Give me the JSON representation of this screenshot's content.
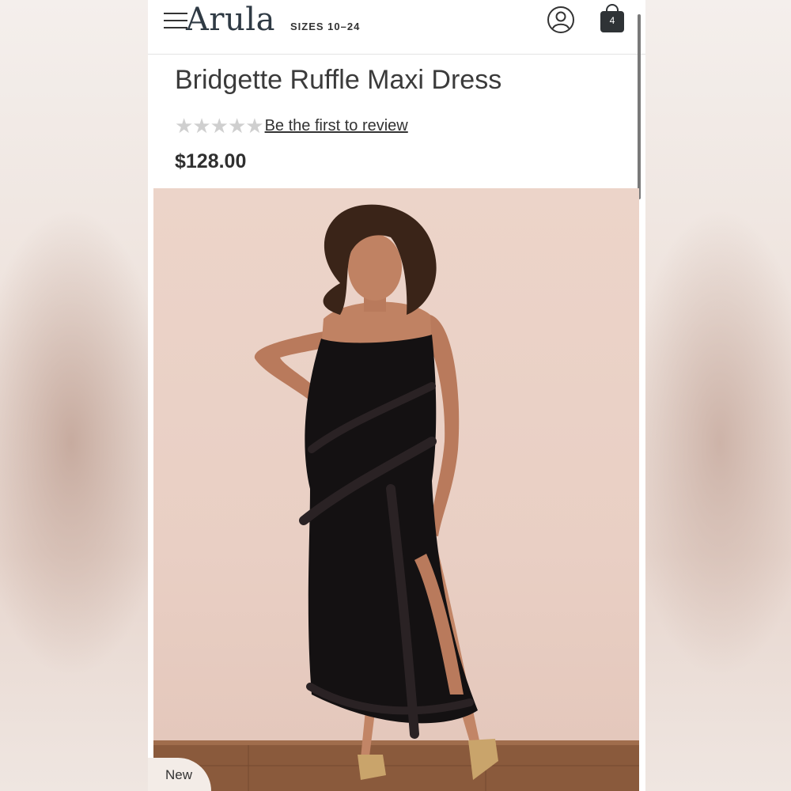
{
  "header": {
    "logo": "Arula",
    "sizes": "SIZES 10–24",
    "cart_count": "4",
    "icons": [
      "menu-icon",
      "account-icon",
      "shopping-bag-icon"
    ]
  },
  "product": {
    "title": "Bridgette Ruffle Maxi Dress",
    "rating_stars": 5,
    "rating_filled": 0,
    "review_link": "Be the first to review",
    "price": "$128.00",
    "badge": "New"
  },
  "colors": {
    "text": "#333333",
    "star_empty": "#cfcfcf",
    "logo": "#2f3a44",
    "dress": "#141112",
    "backdrop": "#e9cfc4"
  }
}
